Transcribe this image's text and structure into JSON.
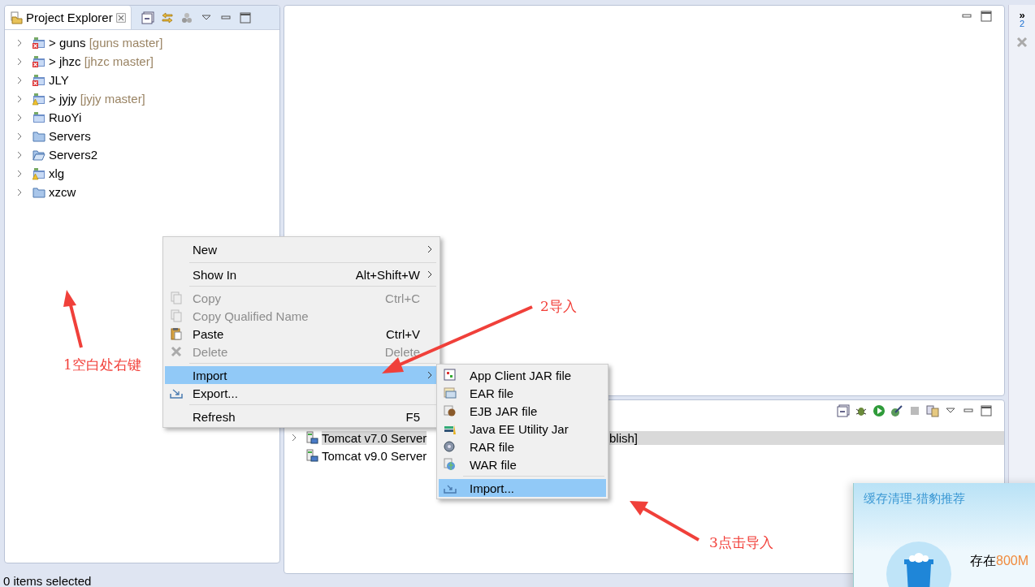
{
  "explorer": {
    "title": "Project Explorer",
    "items": [
      {
        "name": "guns",
        "kind": "project-error",
        "dirty": "> ",
        "branch": "[guns master]"
      },
      {
        "name": "jhzc",
        "kind": "project-error",
        "dirty": "> ",
        "branch": "[jhzc master]"
      },
      {
        "name": "JLY",
        "kind": "project-error"
      },
      {
        "name": "jyjy",
        "kind": "project-warning",
        "dirty": "> ",
        "branch": "[jyjy master]"
      },
      {
        "name": "RuoYi",
        "kind": "project"
      },
      {
        "name": "Servers",
        "kind": "folder"
      },
      {
        "name": "Servers2",
        "kind": "folder-open"
      },
      {
        "name": "xlg",
        "kind": "project-warning"
      },
      {
        "name": "xzcw",
        "kind": "folder"
      }
    ]
  },
  "servers": {
    "rows": [
      {
        "label": "Tomcat v7.0 Server",
        "status": "blish]",
        "selected": true,
        "expandable": true
      },
      {
        "label": "Tomcat v9.0 Server",
        "selected": false,
        "expandable": false
      }
    ]
  },
  "trim": {
    "chevron": "»",
    "count": "2"
  },
  "context_menu": {
    "items": [
      {
        "kind": "item",
        "label": "New",
        "submenu": true,
        "disabled": false,
        "selected": false
      },
      {
        "kind": "separator"
      },
      {
        "kind": "item",
        "label": "Show In",
        "shortcut": "Alt+Shift+W",
        "submenu": true,
        "disabled": false,
        "selected": false
      },
      {
        "kind": "separator"
      },
      {
        "kind": "item",
        "label": "Copy",
        "shortcut": "Ctrl+C",
        "disabled": true,
        "selected": false
      },
      {
        "kind": "item",
        "label": "Copy Qualified Name",
        "disabled": true,
        "selected": false
      },
      {
        "kind": "item",
        "label": "Paste",
        "shortcut": "Ctrl+V",
        "disabled": false,
        "selected": false
      },
      {
        "kind": "item",
        "label": "Delete",
        "shortcut": "Delete",
        "disabled": true,
        "selected": false
      },
      {
        "kind": "separator"
      },
      {
        "kind": "item",
        "label": "Import",
        "submenu": true,
        "disabled": false,
        "selected": true
      },
      {
        "kind": "item",
        "label": "Export...",
        "disabled": false,
        "selected": false
      },
      {
        "kind": "separator"
      },
      {
        "kind": "item",
        "label": "Refresh",
        "shortcut": "F5",
        "disabled": false,
        "selected": false
      }
    ]
  },
  "submenu": {
    "items": [
      {
        "kind": "item",
        "label": "App Client JAR file",
        "selected": false
      },
      {
        "kind": "item",
        "label": "EAR file",
        "selected": false
      },
      {
        "kind": "item",
        "label": "EJB JAR file",
        "selected": false
      },
      {
        "kind": "item",
        "label": "Java EE Utility Jar",
        "selected": false
      },
      {
        "kind": "item",
        "label": "RAR file",
        "selected": false
      },
      {
        "kind": "item",
        "label": "WAR file",
        "selected": false
      },
      {
        "kind": "separator"
      },
      {
        "kind": "item",
        "label": "Import...",
        "selected": true
      }
    ]
  },
  "annotations": [
    {
      "text": "1空白处右键"
    },
    {
      "text": "2导入"
    },
    {
      "text": "3点击导入"
    }
  ],
  "toast": {
    "title": "缓存清理-猎豹推荐",
    "message": "存在",
    "highlight": "800M"
  },
  "status_bar": {
    "text": "0 items selected"
  }
}
